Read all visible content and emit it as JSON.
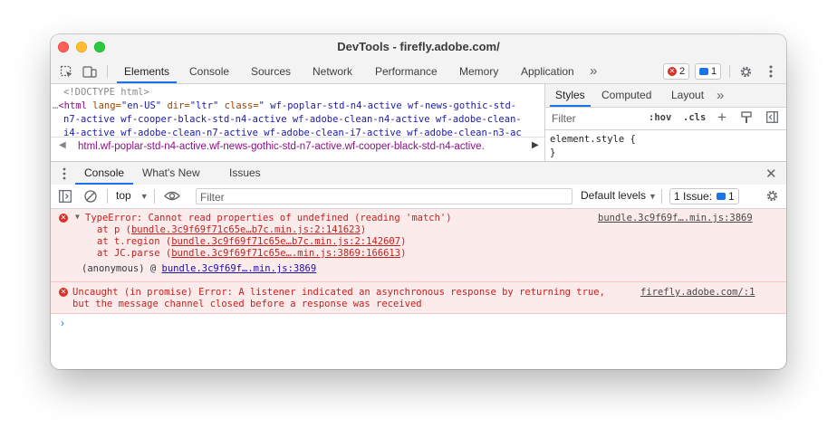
{
  "window": {
    "title": "DevTools - firefly.adobe.com/"
  },
  "toolbar": {
    "tabs": [
      "Elements",
      "Console",
      "Sources",
      "Network",
      "Performance",
      "Memory",
      "Application"
    ],
    "more": "»",
    "error_count": "2",
    "message_count": "1"
  },
  "elements": {
    "doctype": "<!DOCTYPE html>",
    "line1_prefix": "…",
    "line1_tag": "<html ",
    "line1_attr1": "lang=",
    "line1_val1": "\"en-US\"",
    "line1_attr2": " dir=",
    "line1_val2": "\"ltr\"",
    "line1_attr3": " class=",
    "line1_val3": "\" wf-poplar-std-n4-active wf-news-gothic-std-",
    "line2": "n7-active wf-cooper-black-std-n4-active wf-adobe-clean-n4-active wf-adobe-clean-",
    "line3": "i4-active wf-adobe-clean-n7-active wf-adobe-clean-i7-active wf-adobe-clean-n3-ac",
    "breadcrumb_html": "html",
    "breadcrumb_rest": ".wf-poplar-std-n4-active.wf-news-gothic-std-n7-active.wf-cooper-black-std-n4-active."
  },
  "styles": {
    "tabs": [
      "Styles",
      "Computed",
      "Layout"
    ],
    "more": "»",
    "filter_placeholder": "Filter",
    "hov": ":hov",
    "cls": ".cls",
    "element_style": "element.style {",
    "close_brace": "}"
  },
  "drawer": {
    "tabs": [
      "Console",
      "What's New",
      "Issues"
    ]
  },
  "console_toolbar": {
    "context": "top",
    "filter_placeholder": "Filter",
    "levels": "Default levels",
    "issues_label": "1 Issue:",
    "issues_count": "1"
  },
  "messages": [
    {
      "text": "TypeError: Cannot read properties of undefined (reading 'match')",
      "source": "bundle.3c9f69f….min.js:3869",
      "stack": [
        {
          "pre": "at p (",
          "link": "bundle.3c9f69f71c65e…b7c.min.js:2:141623",
          "post": ")"
        },
        {
          "pre": "at t.region (",
          "link": "bundle.3c9f69f71c65e…b7c.min.js:2:142607",
          "post": ")"
        },
        {
          "pre": "at JC.parse (",
          "link": "bundle.3c9f69f71c65e….min.js:3869:166613",
          "post": ")"
        }
      ],
      "anon_pre": "(anonymous) @ ",
      "anon_link": "bundle.3c9f69f….min.js:3869"
    },
    {
      "line1": "Uncaught (in promise) Error: A listener indicated an asynchronous response by returning true,",
      "line2": "but the message channel closed before a response was received",
      "source": "firefly.adobe.com/:1"
    }
  ],
  "prompt": "›",
  "colors": {
    "accent": "#1a73e8",
    "error": "#d93025",
    "error_bg": "#fcebeb"
  }
}
